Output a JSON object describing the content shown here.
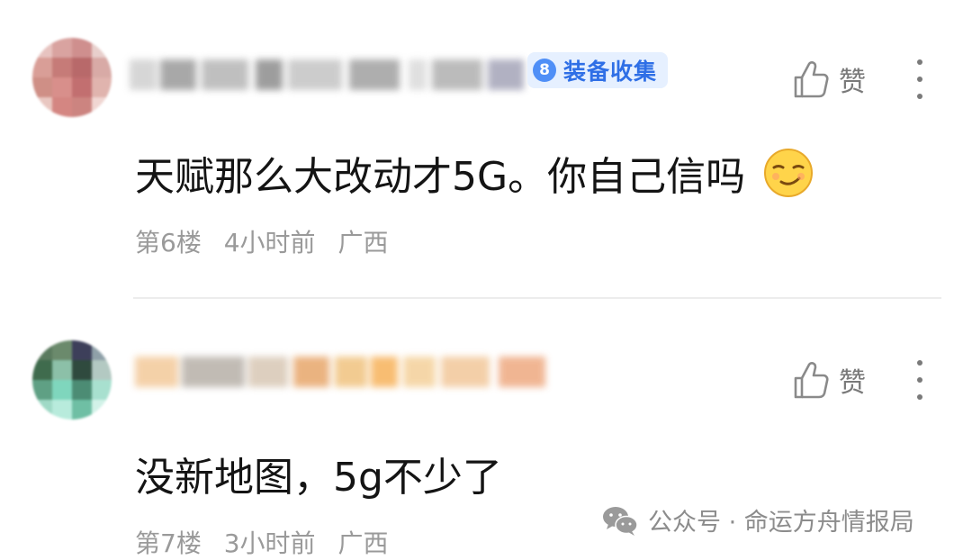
{
  "comments": [
    {
      "username": "",
      "level": "8",
      "badge": "装备收集",
      "text": "天赋那么大改动才5G。你自己信吗",
      "emoji": "smirk-emoji",
      "floor": "第6楼",
      "time": "4小时前",
      "location": "广西",
      "like_label": "赞"
    },
    {
      "username": "",
      "text": "没新地图，5g不少了",
      "floor": "第7楼",
      "time": "3小时前",
      "location": "广西",
      "like_label": "赞"
    }
  ],
  "watermark": {
    "icon": "wechat-icon",
    "text": "公众号 · 命运方舟情报局"
  },
  "colors": {
    "badge_bg": "#e6f0ff",
    "badge_text": "#2f6fe6",
    "meta_text": "#9a9a9a",
    "content_text": "#141414",
    "divider": "#ececec"
  }
}
